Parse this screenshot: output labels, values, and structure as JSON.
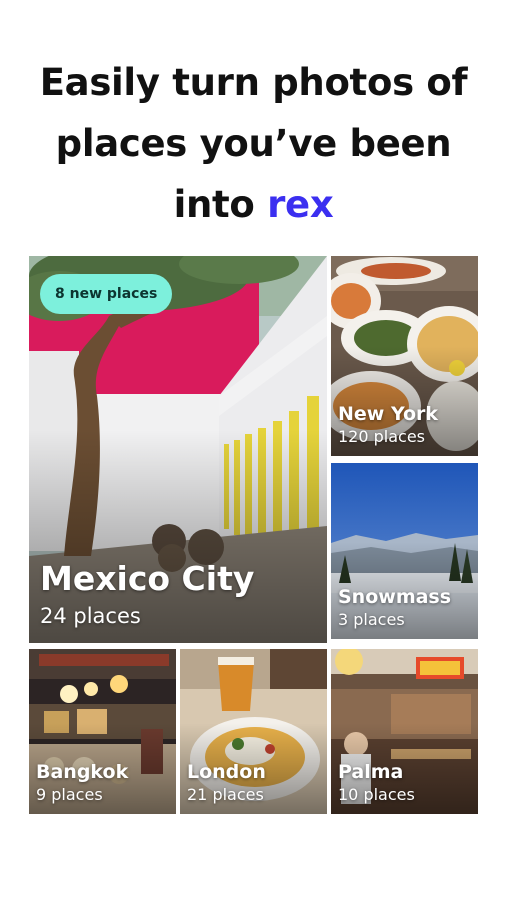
{
  "headline": {
    "line1": "Easily turn photos of",
    "line2": "places you’ve been",
    "line3_prefix": "into ",
    "brand": "rex"
  },
  "colors": {
    "brand": "#3b2ff0",
    "badge_bg": "#7df0dc",
    "text": "#111111"
  },
  "cards": {
    "mexico": {
      "city": "Mexico City",
      "count": "24 places",
      "badge": "8 new places"
    },
    "newyork": {
      "city": "New York",
      "count": "120 places"
    },
    "snowmass": {
      "city": "Snowmass",
      "count": "3 places"
    },
    "bangkok": {
      "city": "Bangkok",
      "count": "9 places"
    },
    "london": {
      "city": "London",
      "count": "21 places"
    },
    "palma": {
      "city": "Palma",
      "count": "10 places"
    }
  }
}
